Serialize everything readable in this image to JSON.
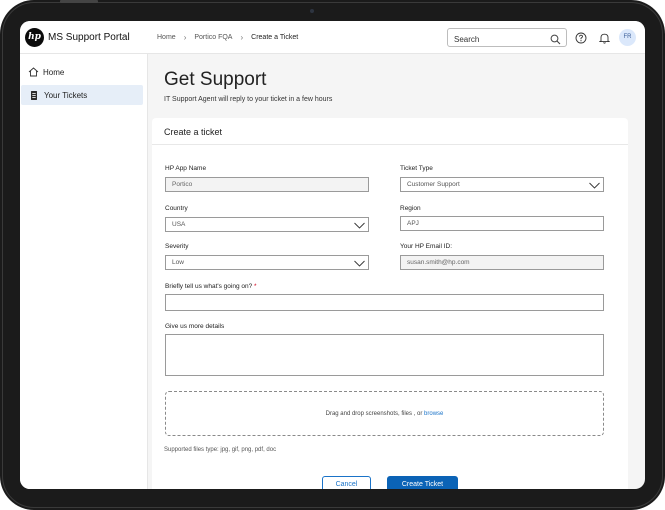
{
  "app": {
    "title": "MS Support Portal",
    "logo_text": "hp"
  },
  "breadcrumb": [
    "Home",
    "Portico FQA",
    "Create a Ticket"
  ],
  "search": {
    "placeholder": "Search"
  },
  "user": {
    "initials": "FR"
  },
  "sidebar": {
    "items": [
      {
        "label": "Home",
        "icon": "home-icon",
        "active": false
      },
      {
        "label": "Your Tickets",
        "icon": "ticket-icon",
        "active": true
      }
    ]
  },
  "page": {
    "title": "Get Support",
    "subtitle": "IT Support Agent will reply to your ticket in a few hours"
  },
  "form": {
    "title": "Create a ticket",
    "fields": {
      "hp_app_name": {
        "label": "HP App Name",
        "value": "Portico"
      },
      "ticket_type": {
        "label": "Ticket Type",
        "value": "Customer Support"
      },
      "country": {
        "label": "Country",
        "value": "USA"
      },
      "region": {
        "label": "Region",
        "value": "APJ"
      },
      "severity": {
        "label": "Severity",
        "value": "Low"
      },
      "email": {
        "label": "Your HP Email ID:",
        "value": "susan.smith@hp.com"
      },
      "summary": {
        "label": "Briefly tell us what's going on?",
        "required_mark": "*"
      },
      "details": {
        "label": "Give us more details"
      }
    },
    "dropzone": {
      "text": "Drag and drop screenshots, files , or ",
      "link": "browse"
    },
    "supported_types": "Supported files type: jpg, gif, png, pdf, doc",
    "cancel_label": "Cancel",
    "create_label": "Create Ticket"
  },
  "colors": {
    "accent": "#0b63b6",
    "active_nav": "#e6eef8",
    "required": "#d0021b"
  }
}
